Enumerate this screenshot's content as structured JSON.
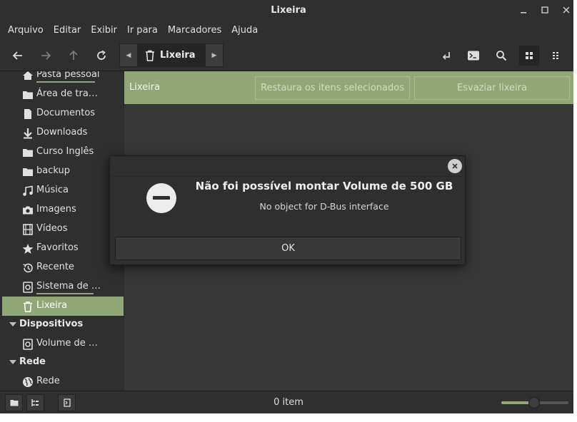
{
  "window": {
    "title": "Lixeira"
  },
  "menu": [
    "Arquivo",
    "Editar",
    "Exibir",
    "Ir para",
    "Marcadores",
    "Ajuda"
  ],
  "toolbar": {
    "path": {
      "current": "Lixeira",
      "icon": "trash-icon"
    }
  },
  "sidebar": {
    "places": [
      {
        "label": "Pasta pessoal",
        "icon": "home-icon"
      },
      {
        "label": "Área de tra…",
        "icon": "folder-icon"
      },
      {
        "label": "Documentos",
        "icon": "document-icon"
      },
      {
        "label": "Downloads",
        "icon": "download-icon"
      },
      {
        "label": "Curso Inglês",
        "icon": "folder-icon"
      },
      {
        "label": "backup",
        "icon": "folder-icon"
      },
      {
        "label": "Música",
        "icon": "music-icon"
      },
      {
        "label": "Imagens",
        "icon": "camera-icon"
      },
      {
        "label": "Vídeos",
        "icon": "film-icon"
      },
      {
        "label": "Favoritos",
        "icon": "star-icon"
      },
      {
        "label": "Recente",
        "icon": "history-icon"
      },
      {
        "label": "Sistema de …",
        "icon": "drive-icon"
      },
      {
        "label": "Lixeira",
        "icon": "trash-icon"
      }
    ],
    "devices_header": "Dispositivos",
    "devices": [
      {
        "label": "Volume de …",
        "icon": "drive-icon"
      }
    ],
    "network_header": "Rede",
    "network": [
      {
        "label": "Rede",
        "icon": "globe-icon"
      }
    ]
  },
  "trashbar": {
    "title": "Lixeira",
    "restore_label": "Restaura os itens selecionados",
    "empty_label": "Esvaziar lixeira"
  },
  "status": {
    "text": "0 item",
    "zoom_level": 0.49
  },
  "dialog": {
    "title": "Não foi possível montar Volume de 500 GB",
    "message": "No object for D-Bus interface",
    "ok_label": "OK",
    "icon": "error-icon"
  },
  "colors": {
    "accent": "#8fa876",
    "background": "#383838",
    "chrome": "#2f2f2f"
  }
}
